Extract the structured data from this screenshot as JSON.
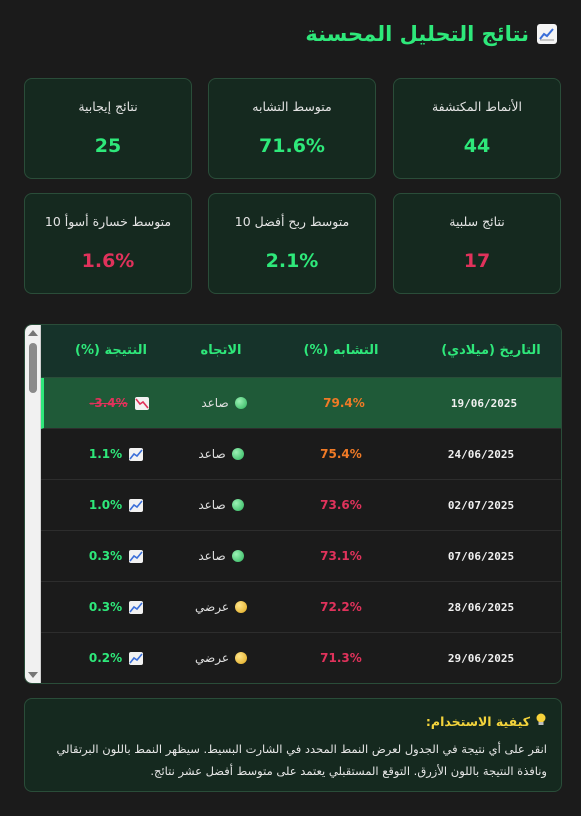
{
  "header": {
    "title": "نتائج التحليل المحسنة",
    "icon": "chart-up-icon"
  },
  "stats": [
    {
      "label": "الأنماط المكتشفة",
      "value": "44",
      "color": "green"
    },
    {
      "label": "متوسط التشابه",
      "value": "71.6%",
      "color": "green"
    },
    {
      "label": "نتائج إيجابية",
      "value": "25",
      "color": "green"
    },
    {
      "label": "نتائج سلبية",
      "value": "17",
      "color": "red"
    },
    {
      "label": "متوسط ربح أفضل 10",
      "value": "2.1%",
      "color": "green"
    },
    {
      "label": "متوسط خسارة أسوأ 10",
      "value": "1.6%",
      "color": "red"
    }
  ],
  "table": {
    "headers": {
      "date": "التاريخ (ميلادي)",
      "similarity": "التشابه (%)",
      "direction": "الاتجاه",
      "result": "النتيجة (%)"
    },
    "rows": [
      {
        "date": "19/06/2025",
        "similarity": "79.4%",
        "direction": "صاعد",
        "dir_type": "up",
        "result": "-3.4%",
        "result_type": "down",
        "selected": true
      },
      {
        "date": "24/06/2025",
        "similarity": "75.4%",
        "direction": "صاعد",
        "dir_type": "up",
        "result": "1.1%",
        "result_type": "up",
        "selected": false
      },
      {
        "date": "02/07/2025",
        "similarity": "73.6%",
        "direction": "صاعد",
        "dir_type": "up",
        "result": "1.0%",
        "result_type": "up",
        "selected": false
      },
      {
        "date": "07/06/2025",
        "similarity": "73.1%",
        "direction": "صاعد",
        "dir_type": "up",
        "result": "0.3%",
        "result_type": "up",
        "selected": false
      },
      {
        "date": "28/06/2025",
        "similarity": "72.2%",
        "direction": "عرضي",
        "dir_type": "side",
        "result": "0.3%",
        "result_type": "up",
        "selected": false
      },
      {
        "date": "29/06/2025",
        "similarity": "71.3%",
        "direction": "عرضي",
        "dir_type": "side",
        "result": "0.2%",
        "result_type": "up",
        "selected": false
      }
    ]
  },
  "help": {
    "icon": "lightbulb-icon",
    "title": "كيفية الاستخدام:",
    "line1": "انقر على أي نتيجة في الجدول لعرض النمط المحدد في الشارت البسيط. سيظهر النمط باللون البرتقالي",
    "line2": "ونافذة النتيجة باللون الأزرق. التوقع المستقبلي يعتمد على متوسط أفضل عشر نتائج."
  },
  "colors": {
    "accent": "#2ee87a",
    "negative": "#e0325b",
    "orange": "#f07a26",
    "card_bg": "#15291f"
  }
}
